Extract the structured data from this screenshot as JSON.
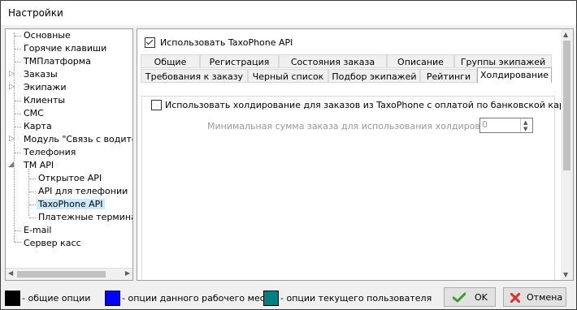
{
  "window": {
    "title": "Настройки"
  },
  "tree": {
    "items": [
      {
        "label": "Основные"
      },
      {
        "label": "Горячие клавиши"
      },
      {
        "label": "ТМПлатформа"
      },
      {
        "label": "Заказы"
      },
      {
        "label": "Экипажи"
      },
      {
        "label": "Клиенты"
      },
      {
        "label": "СМС"
      },
      {
        "label": "Карта"
      },
      {
        "label": "Модуль \"Связь с водителем\""
      },
      {
        "label": "Телефония"
      },
      {
        "label": "TM API"
      },
      {
        "label": "Открытое API"
      },
      {
        "label": "API для телефонии"
      },
      {
        "label": "TaxoPhone API"
      },
      {
        "label": "Платежные терминалы"
      },
      {
        "label": "E-mail"
      },
      {
        "label": "Сервер касс"
      }
    ]
  },
  "panel": {
    "use_api_label": "Использовать TaxoPhone API",
    "tabs_row1": [
      "Общие",
      "Регистрация",
      "Состояния заказа",
      "Описание",
      "Группы экипажей"
    ],
    "tabs_row2": [
      "Требования к заказу",
      "Черный список",
      "Подбор экипажей",
      "Рейтинги",
      "Холдирование"
    ],
    "active_tab": "Холдирование",
    "holding_checkbox_label": "Использовать холдирование для заказов из TaxoPhone с оплатой по банковской карте",
    "min_sum_label": "Минимальная сумма заказа для использования холдирования",
    "min_sum_value": "0"
  },
  "footer": {
    "legend": [
      {
        "label": "- общие опции",
        "color": "#000000"
      },
      {
        "label": "- опции данного рабочего места",
        "color": "#0000ff"
      },
      {
        "label": "- опции текущего пользователя",
        "color": "#008080"
      }
    ],
    "ok_label": "OK",
    "cancel_label": "Отмена"
  },
  "colors": {
    "ok_icon": "#3c9a2e",
    "cancel_icon": "#d9352c",
    "selection": "#cce8ff"
  }
}
